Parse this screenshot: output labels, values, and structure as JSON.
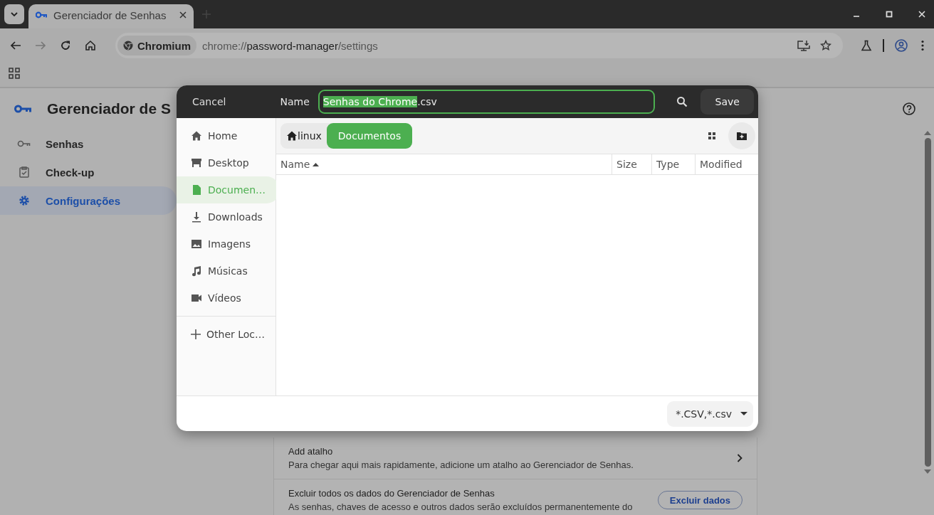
{
  "browser": {
    "tabs": [
      {
        "title": "Gerenciador de Senhas",
        "selected": true
      }
    ],
    "chip": "Chromium",
    "url": {
      "scheme": "chrome://",
      "host": "password-manager",
      "path": "/settings"
    }
  },
  "page": {
    "title": "Gerenciador de S",
    "nav": [
      {
        "label": "Senhas",
        "kind": "key",
        "selected": false
      },
      {
        "label": "Check-up",
        "kind": "clipboard",
        "selected": false
      },
      {
        "label": "Configurações",
        "kind": "gear",
        "selected": true
      }
    ],
    "rows": [
      {
        "kind": "link",
        "title": "Add atalho",
        "description": "Para chegar aqui mais rapidamente, adicione um atalho ao Gerenciador de Senhas."
      },
      {
        "kind": "button",
        "title": "Excluir todos os dados do Gerenciador de Senhas",
        "description": "As senhas, chaves de acesso e outros dados serão excluídos permanentemente do",
        "button": "Excluir dados"
      }
    ]
  },
  "dialog": {
    "cancel": "Cancel",
    "name_label": "Name",
    "name_value": {
      "selected_text": "Senhas do Chrome",
      "rest": ".csv"
    },
    "save": "Save",
    "places": [
      {
        "label": "Home",
        "kind": "home",
        "selected": false
      },
      {
        "label": "Desktop",
        "kind": "desktop",
        "selected": false
      },
      {
        "label": "Documen…",
        "kind": "document",
        "selected": true
      },
      {
        "label": "Downloads",
        "kind": "download",
        "selected": false
      },
      {
        "label": "Imagens",
        "kind": "image",
        "selected": false
      },
      {
        "label": "Músicas",
        "kind": "music",
        "selected": false
      },
      {
        "label": "Vídeos",
        "kind": "video",
        "selected": false
      }
    ],
    "other": "Other Loc…",
    "path": [
      {
        "label": "linux",
        "kind": "home",
        "selected": false
      },
      {
        "label": "Documentos",
        "kind": "folder",
        "selected": true
      }
    ],
    "columns": [
      {
        "label": "Name",
        "sorted": true
      },
      {
        "label": "Size",
        "sorted": false
      },
      {
        "label": "Type",
        "sorted": false
      },
      {
        "label": "Modified",
        "sorted": false
      }
    ],
    "filter": "*.CSV,*.csv"
  }
}
